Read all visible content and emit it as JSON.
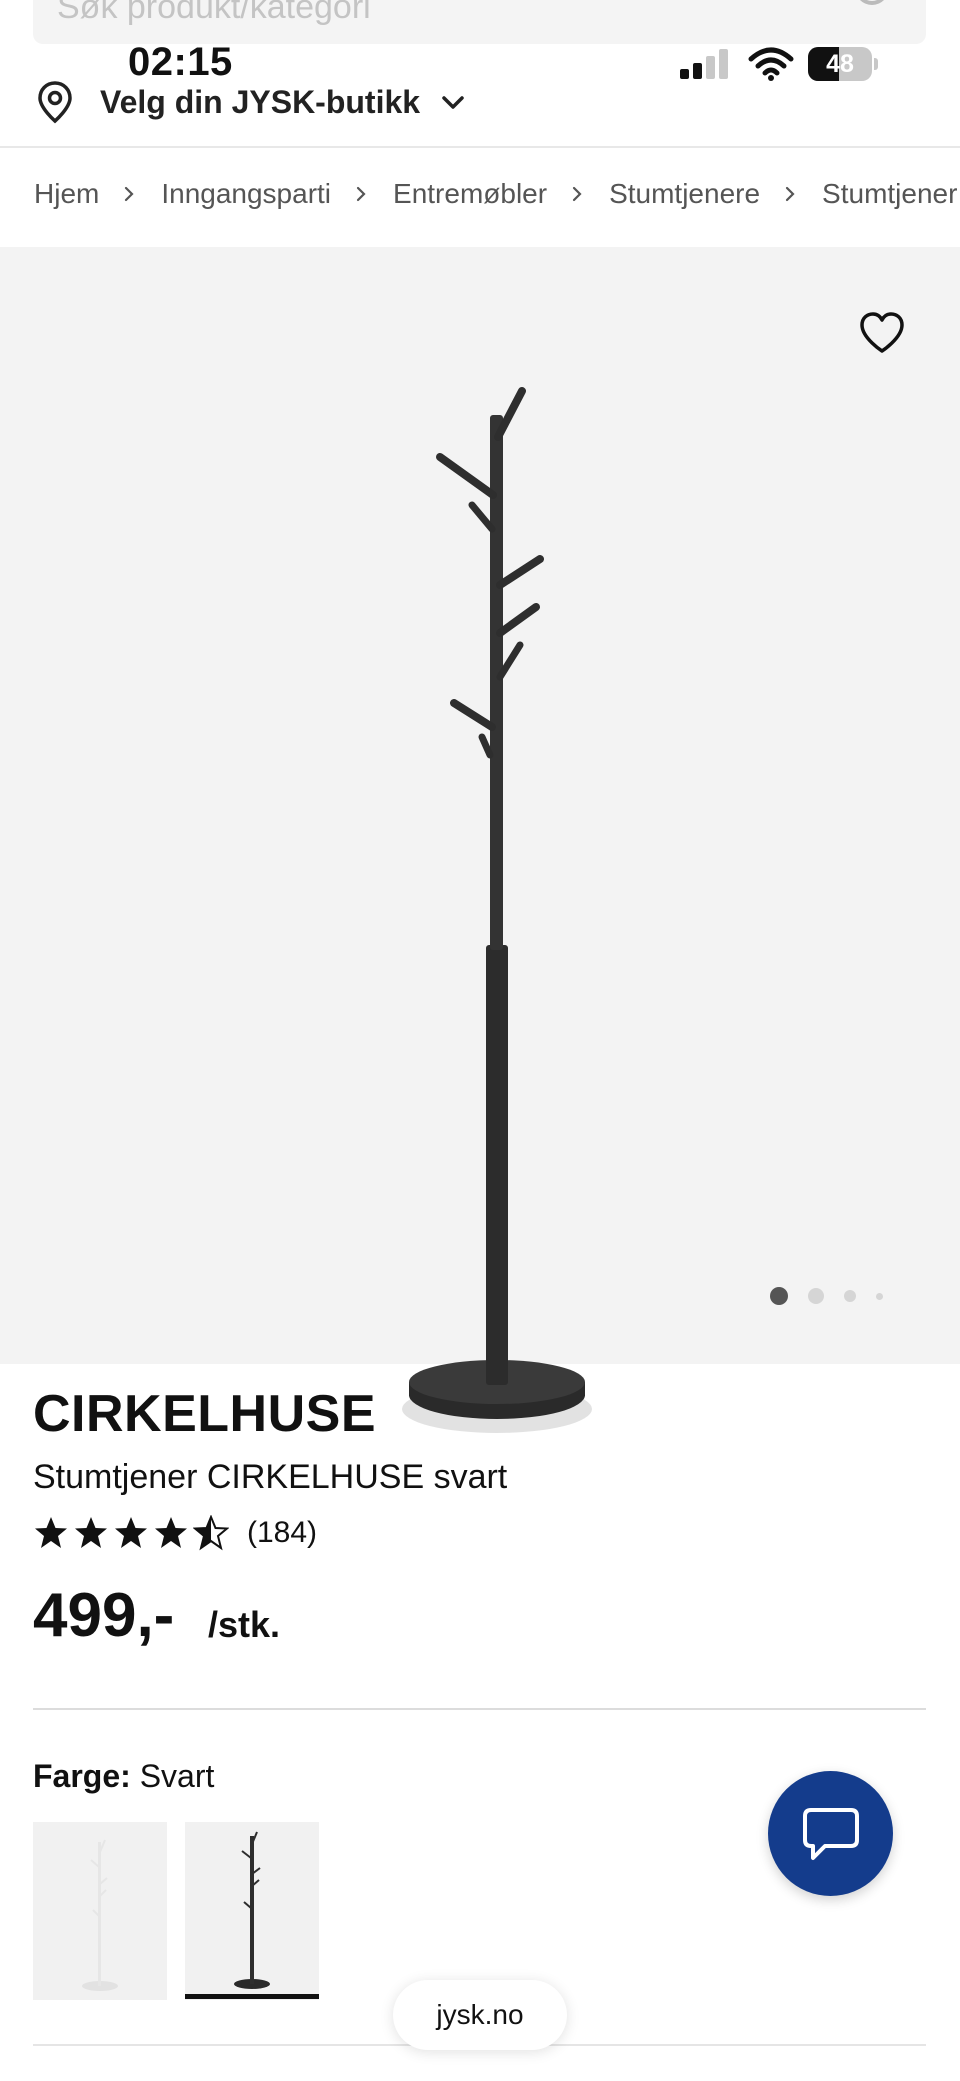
{
  "search": {
    "placeholder": "Søk produkt/kategori"
  },
  "status_bar": {
    "time": "02:15",
    "battery_level": 48,
    "battery_text": "48"
  },
  "store": {
    "label": "Velg din JYSK-butikk"
  },
  "breadcrumb": [
    "Hjem",
    "Inngangsparti",
    "Entremøbler",
    "Stumtjenere",
    "Stumtjener"
  ],
  "gallery": {
    "image_count": 4,
    "active_index": 0
  },
  "product": {
    "brand": "CIRKELHUSE",
    "name": "Stumtjener CIRKELHUSE svart",
    "rating": 4.5,
    "review_count": "(184)",
    "price": "499,-",
    "unit": "/stk."
  },
  "color": {
    "label": "Farge:",
    "value": "Svart",
    "options": [
      {
        "name": "hvit",
        "selected": false
      },
      {
        "name": "svart",
        "selected": true
      }
    ]
  },
  "browser": {
    "domain": "jysk.no"
  },
  "colors": {
    "accent": "#143c8c",
    "text": "#111111",
    "image_bg": "#f3f3f3"
  },
  "icons": {
    "search": "search-icon",
    "location": "location-pin-icon",
    "dropdown": "chevron-down-icon",
    "breadcrumb_separator": "chevron-right-icon",
    "favorite": "heart-icon",
    "chat": "chat-bubble-icon",
    "star": "star-icon"
  }
}
